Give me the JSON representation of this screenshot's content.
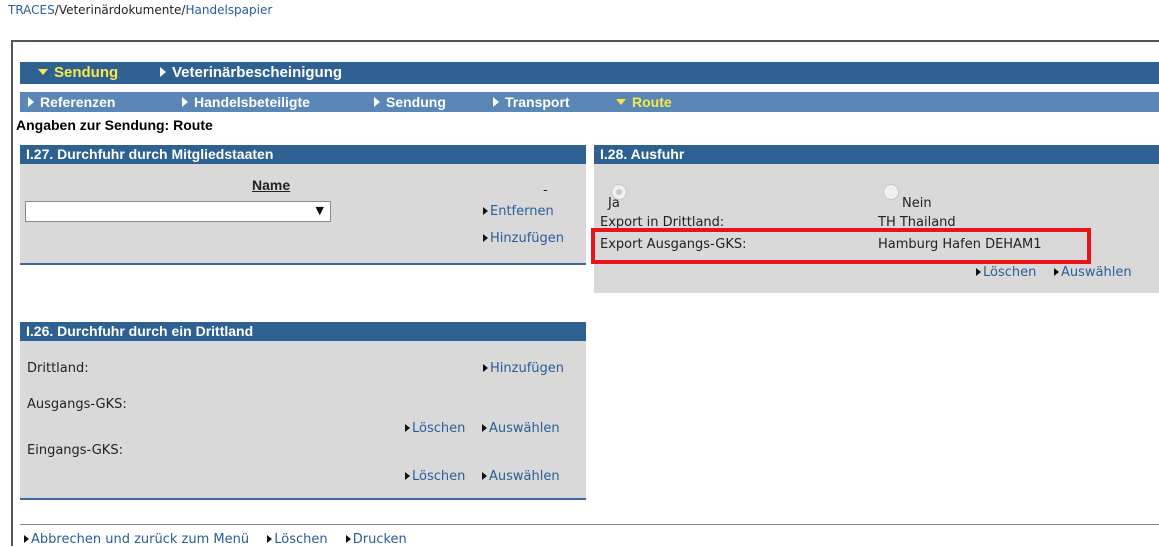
{
  "breadcrumb": {
    "items": [
      "TRACES",
      "Veterinärdokumente",
      "Handelspapier"
    ],
    "separator": "/"
  },
  "main_tabs": [
    {
      "label": "Sendung",
      "active": true
    },
    {
      "label": "Veterinärbescheinigung",
      "active": false
    }
  ],
  "sub_tabs": [
    {
      "label": "Referenzen",
      "active": false
    },
    {
      "label": "Handelsbeteiligte",
      "active": false
    },
    {
      "label": "Sendung",
      "active": false
    },
    {
      "label": "Transport",
      "active": false
    },
    {
      "label": "Route",
      "active": true
    }
  ],
  "page_title": "Angaben zur Sendung: Route",
  "panel_transit_ms": {
    "title": "I.27. Durchfuhr durch Mitgliedstaaten",
    "column_header": "Name",
    "dash": "-",
    "select_value": "",
    "remove_link": "Entfernen",
    "add_link": "Hinzufügen"
  },
  "panel_export": {
    "title": "I.28. Ausfuhr",
    "radio_yes": "Ja",
    "radio_no": "Nein",
    "selected": "Ja",
    "export_country_label": "Export in Drittland:",
    "export_country_value": "TH Thailand",
    "exit_bip_label": "Export Ausgangs-GKS:",
    "exit_bip_value": "Hamburg Hafen DEHAM1",
    "delete_link": "Löschen",
    "select_link": "Auswählen"
  },
  "panel_transit_third": {
    "title": "I.26. Durchfuhr durch ein Drittland",
    "third_country_label": "Drittland:",
    "add_link": "Hinzufügen",
    "exit_bip_label": "Ausgangs-GKS:",
    "entry_bip_label": "Eingangs-GKS:",
    "delete_link": "Löschen",
    "select_link": "Auswählen"
  },
  "footer": {
    "cancel_link": "Abbrechen und zurück zum Menü",
    "delete_link": "Löschen",
    "print_link": "Drucken"
  },
  "colors": {
    "header_blue": "#2e6192",
    "subtab_blue": "#5a87b6",
    "active_tab": "#f5e84a",
    "panel_bg": "#d9d9d9",
    "highlight": "#e8141a",
    "link": "#2a5d9a"
  }
}
